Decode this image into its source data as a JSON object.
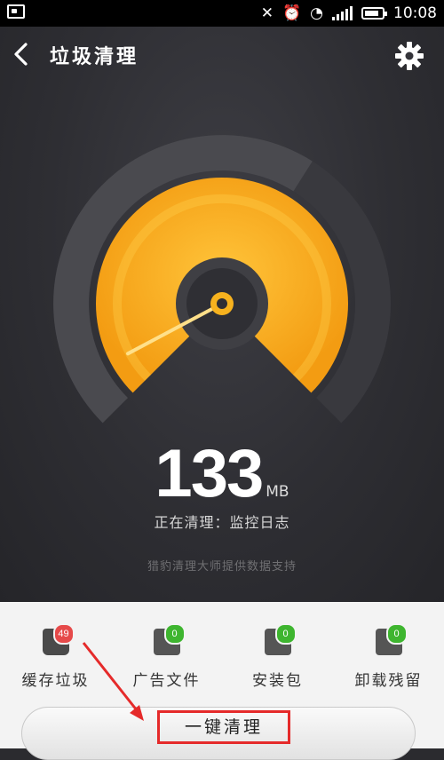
{
  "status_bar": {
    "time": "10:08",
    "battery_level": 0.85
  },
  "header": {
    "title": "垃圾清理",
    "back_icon": "chevron-left-icon",
    "settings_icon": "gear-icon"
  },
  "gauge": {
    "fill_fraction": 0.62,
    "accent_color": "#F7B21E",
    "track_color": "#4a4a4f"
  },
  "scan": {
    "value": "133",
    "unit": "MB",
    "cleaning_status": "正在清理：监控日志",
    "support_text": "猎豹清理大师提供数据支持"
  },
  "categories": [
    {
      "label": "缓存垃圾",
      "badge": "49",
      "badge_color": "#E64A4A",
      "icon": "cache-trash-icon"
    },
    {
      "label": "广告文件",
      "badge": "0",
      "badge_color": "#3EB52F",
      "icon": "ad-file-icon"
    },
    {
      "label": "安装包",
      "badge": "0",
      "badge_color": "#3EB52F",
      "icon": "install-package-icon"
    },
    {
      "label": "卸载残留",
      "badge": "0",
      "badge_color": "#3EB52F",
      "icon": "uninstall-residue-icon"
    }
  ],
  "action": {
    "clean_label": "一键清理"
  },
  "annotation": {
    "highlight_color": "#E52A2A"
  }
}
